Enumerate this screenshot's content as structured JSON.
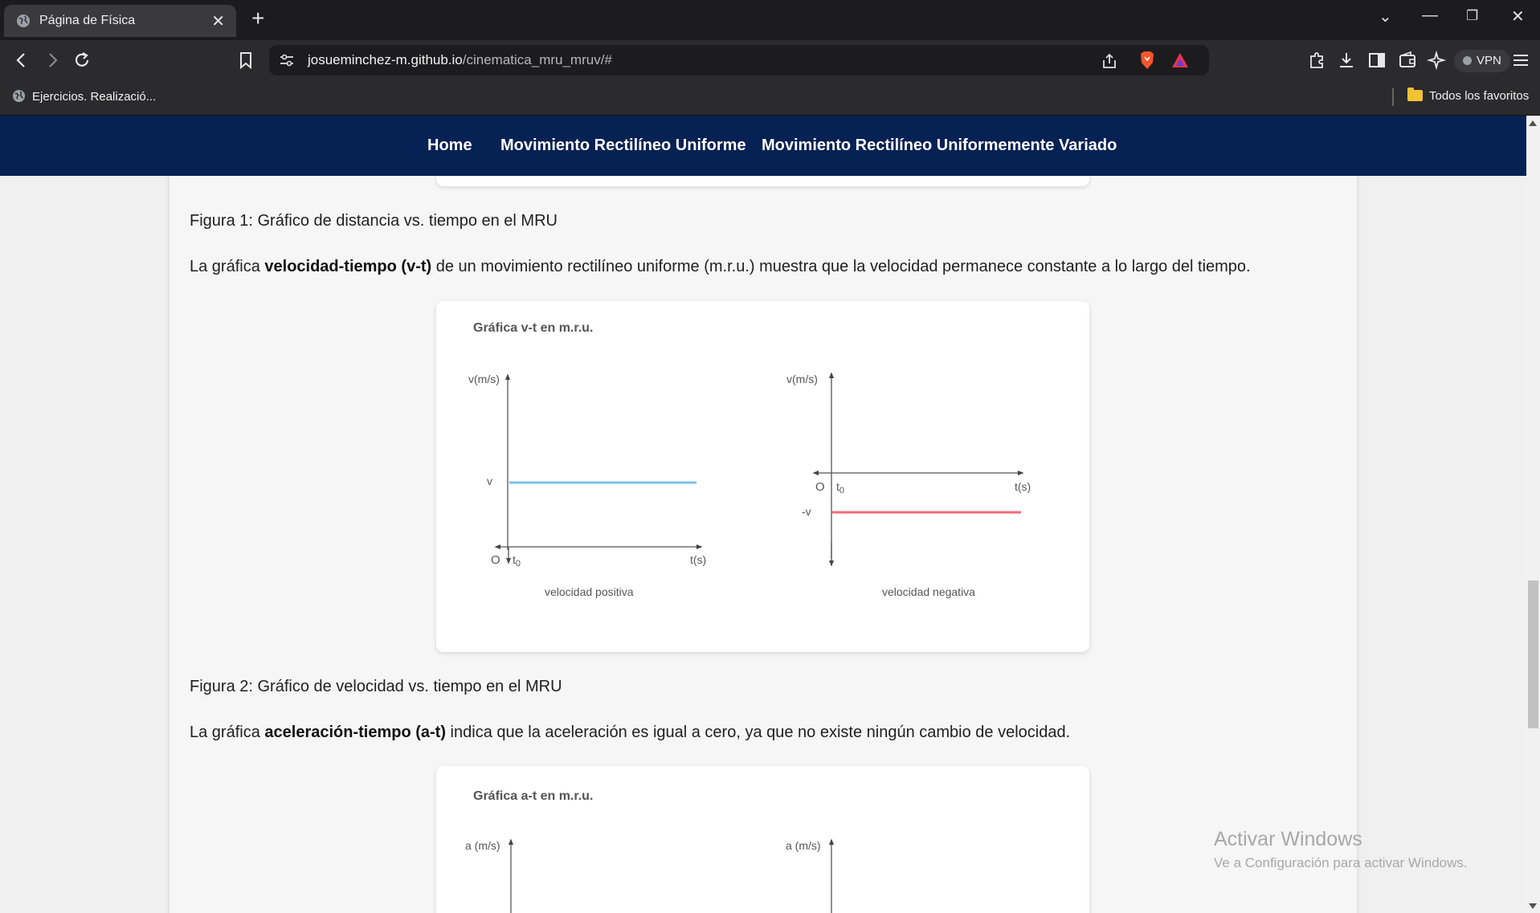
{
  "browser": {
    "tab_title": "Página de Física",
    "url_host": "josueminchez-m.github.io",
    "url_path": "/cinematica_mru_mruv/#",
    "vpn_label": "VPN",
    "bookmark_item": "Ejercicios. Realizació...",
    "bookmark_folder": "Todos los favoritos"
  },
  "nav": {
    "home": "Home",
    "mru": "Movimiento Rectilíneo Uniforme",
    "mruv": "Movimiento Rectilíneo Uniformemente Variado"
  },
  "content": {
    "caption1": "Figura 1: Gráfico de distancia vs. tiempo en el MRU",
    "para1_pre": "La gráfica ",
    "para1_bold": "velocidad-tiempo (v-t)",
    "para1_post": " de un movimiento rectilíneo uniforme (m.r.u.) muestra que la velocidad permanece constante a lo largo del tiempo.",
    "caption2": "Figura 2: Gráfico de velocidad vs. tiempo en el MRU",
    "para2_pre": "La gráfica ",
    "para2_bold": "aceleración-tiempo (a-t)",
    "para2_post": " indica que la aceleración es igual a cero, ya que no existe ningún cambio de velocidad."
  },
  "figure_vt": {
    "title": "Gráfica v-t en m.r.u.",
    "left": {
      "y_axis": "v(m/s)",
      "x_axis": "t(s)",
      "value_label": "v",
      "origin": "O",
      "t0": "t",
      "t0_sub": "0",
      "caption": "velocidad positiva",
      "color": "#7cc0ea"
    },
    "right": {
      "y_axis": "v(m/s)",
      "x_axis": "t(s)",
      "value_label": "-v",
      "origin": "O",
      "t0": "t",
      "t0_sub": "0",
      "caption": "velocidad negativa",
      "color": "#f06b7a"
    }
  },
  "figure_at": {
    "title": "Gráfica a-t en m.r.u.",
    "left_y_axis": "a (m/s)",
    "right_y_axis": "a (m/s)"
  },
  "watermark": {
    "line1": "Activar Windows",
    "line2": "Ve a Configuración para activar Windows."
  }
}
